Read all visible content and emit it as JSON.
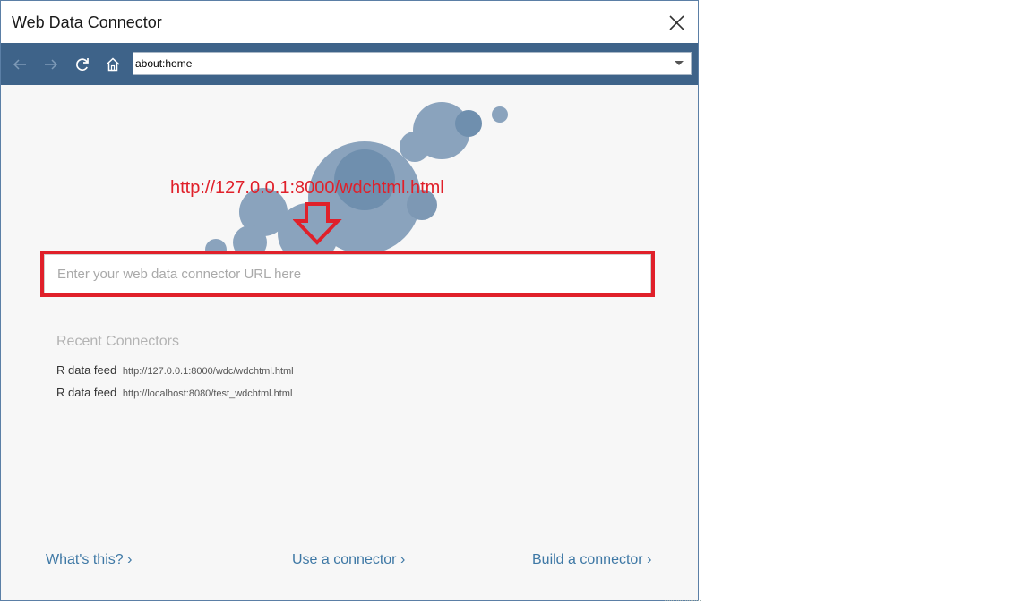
{
  "window": {
    "title": "Web Data Connector"
  },
  "icons": {
    "close": "close-icon",
    "back": "arrow-left-icon",
    "forward": "arrow-right-icon",
    "refresh": "refresh-icon",
    "home": "home-icon",
    "dropdown": "chevron-down-icon"
  },
  "address": {
    "value": "about:home"
  },
  "annotation": {
    "url": "http://127.0.0.1:8000/wdchtml.html"
  },
  "url_input": {
    "placeholder": "Enter your web data connector URL here",
    "value": ""
  },
  "recent": {
    "title": "Recent Connectors",
    "items": [
      {
        "name": "R data feed",
        "url": "http://127.0.0.1:8000/wdc/wdchtml.html"
      },
      {
        "name": "R data feed",
        "url": "http://localhost:8080/test_wdchtml.html"
      }
    ]
  },
  "footer": {
    "whats_this": "What's this? ›",
    "use_connector": "Use a connector ›",
    "build_connector": "Build a connector ›"
  },
  "colors": {
    "toolbar": "#3e6389",
    "bubble": "#5b7fa6",
    "annotation_red": "#e0202a",
    "link": "#3e78a5"
  }
}
